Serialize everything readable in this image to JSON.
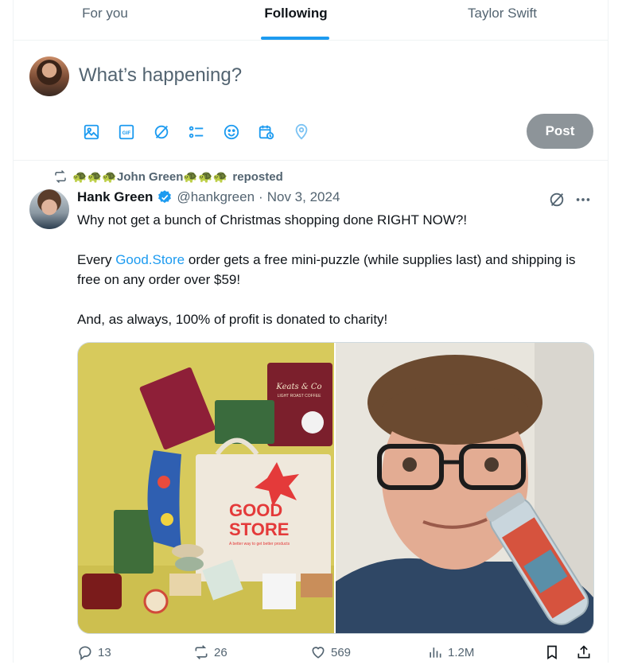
{
  "tabs": [
    {
      "label": "For you",
      "active": false
    },
    {
      "label": "Following",
      "active": true
    },
    {
      "label": "Taylor Swift",
      "active": false
    }
  ],
  "composer": {
    "placeholder": "What’s happening?",
    "post_label": "Post",
    "tools": [
      "image-icon",
      "gif-icon",
      "grok-icon",
      "poll-icon",
      "emoji-icon",
      "schedule-icon",
      "location-icon"
    ]
  },
  "tweet": {
    "reposted_by": "🐢🐢🐢John Green🐢🐢🐢",
    "reposted_label": "reposted",
    "author": {
      "name": "Hank Green",
      "handle": "@hankgreen",
      "date": "Nov 3, 2024",
      "verified": true
    },
    "text": {
      "line1": "Why not get a bunch of Christmas shopping done RIGHT NOW?!",
      "p2_before": "Every ",
      "p2_link": "Good.Store",
      "p2_after": " order gets a free mini-puzzle (while supplies last) and shipping is free on any order over $59!",
      "p3": "And, as always, 100% of profit is donated to charity!"
    },
    "media": {
      "left": {
        "brand_good": "GOOD",
        "brand_store": "STORE",
        "tagline": "A better way to get better products",
        "coffee_brand": "Keats & Co",
        "coffee_sub": "LIGHT ROAST COFFEE"
      }
    },
    "stats": {
      "replies": "13",
      "reposts": "26",
      "likes": "569",
      "views": "1.2M"
    }
  },
  "colors": {
    "accent": "#1d9bf0",
    "text_secondary": "#536471",
    "post_button": "#8d9499"
  }
}
